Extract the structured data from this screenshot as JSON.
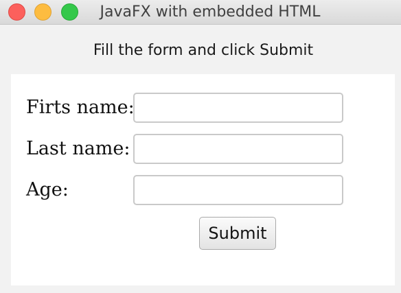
{
  "window": {
    "title": "JavaFX with embedded HTML"
  },
  "header": {
    "instruction": "Fill the form and click Submit"
  },
  "form": {
    "first_name_label": "Firts name:",
    "first_name_value": "",
    "last_name_label": "Last name:",
    "last_name_value": "",
    "age_label": "Age:",
    "age_value": "",
    "submit_label": "Submit"
  },
  "colors": {
    "close": "#fc605c",
    "minimize": "#fdbc40",
    "maximize": "#34c84a",
    "window_background": "#f2f2f2",
    "content_background": "#ffffff"
  }
}
